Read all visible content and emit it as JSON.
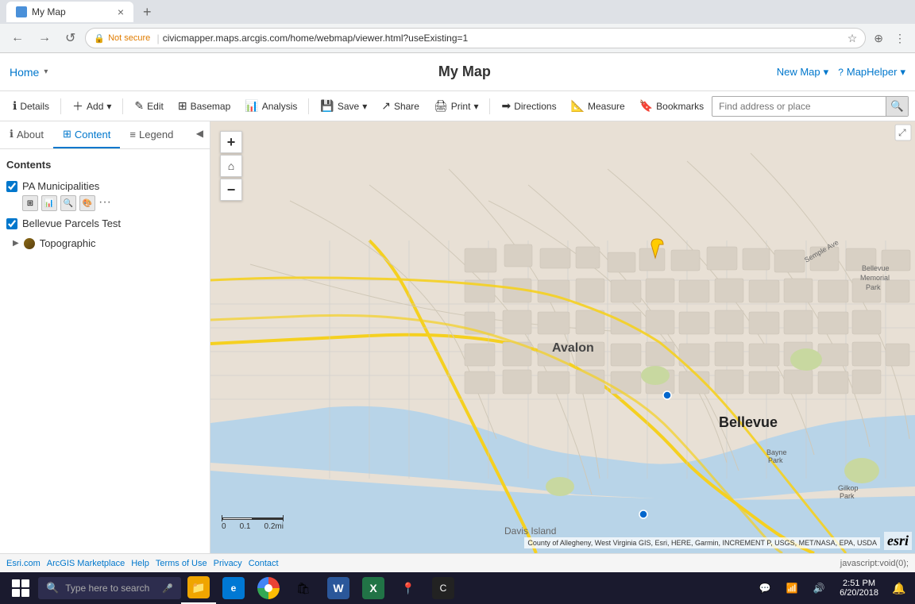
{
  "browser": {
    "tab_title": "My Map",
    "tab_favicon": "map",
    "address_bar": "civicmapper.maps.arcgis.com/home/webmap/viewer.html?useExisting=1",
    "security_label": "Not secure",
    "new_tab_label": "+"
  },
  "app": {
    "logo_text": "Home",
    "logo_arrow": "▾",
    "title": "My Map",
    "header_new_map": "New Map",
    "header_new_map_arrow": "▾",
    "header_map_helper": "MapHelper",
    "header_map_helper_arrow": "▾"
  },
  "toolbar": {
    "details_label": "Details",
    "add_label": "Add",
    "add_arrow": "▾",
    "edit_label": "Edit",
    "basemap_label": "Basemap",
    "analysis_label": "Analysis",
    "save_label": "Save",
    "save_arrow": "▾",
    "share_label": "Share",
    "print_label": "Print",
    "print_arrow": "▾",
    "directions_label": "Directions",
    "measure_label": "Measure",
    "bookmarks_label": "Bookmarks",
    "search_placeholder": "Find address or place"
  },
  "sidebar": {
    "about_tab": "About",
    "content_tab": "Content",
    "legend_tab": "Legend",
    "contents_header": "Contents",
    "layers": [
      {
        "id": "pa-municipalities",
        "name": "PA Municipalities",
        "checked": true,
        "has_icons": true
      },
      {
        "id": "bellevue-parcels",
        "name": "Bellevue Parcels Test",
        "checked": true,
        "has_icons": false
      },
      {
        "id": "topographic",
        "name": "Topographic",
        "checked": false,
        "has_icons": false,
        "is_basemap": true
      }
    ]
  },
  "map": {
    "zoom_in": "+",
    "zoom_out": "−",
    "home": "⌂",
    "attribution": "County of Allegheny, West Virginia GIS, Esri, HERE, Garmin, INCREMENT P, USGS, MET/NASA, EPA, USDA",
    "esri_logo": "esri",
    "scale_labels": [
      "0",
      "0.1",
      "0.2mi"
    ]
  },
  "status_bar": {
    "links": [
      "Esri.com",
      "ArcGIS Marketplace",
      "Help",
      "Terms of Use",
      "Privacy",
      "Contact"
    ],
    "url_text": "javascript:void(0);"
  },
  "taskbar": {
    "search_placeholder": "Type here to search",
    "time": "2:51 PM",
    "date": "6/20/2018",
    "apps": [
      {
        "name": "file-explorer",
        "color": "#f0a500",
        "icon": "📁"
      },
      {
        "name": "edge-browser",
        "color": "#0078d4",
        "icon": "e"
      },
      {
        "name": "chrome-browser",
        "color": "#4caf50",
        "icon": "●"
      },
      {
        "name": "store",
        "color": "#0078d4",
        "icon": "🛍"
      },
      {
        "name": "word",
        "color": "#2b579a",
        "icon": "W"
      },
      {
        "name": "excel",
        "color": "#217346",
        "icon": "X"
      },
      {
        "name": "maps",
        "color": "#e44",
        "icon": "📍"
      },
      {
        "name": "app8",
        "color": "#333",
        "icon": "C"
      }
    ]
  },
  "icons": {
    "info": "ℹ",
    "layers": "⊞",
    "legend": "≡",
    "add": "＋",
    "edit": "✎",
    "basemap": "🗺",
    "analysis": "📊",
    "save": "💾",
    "share": "↗",
    "print": "🖨",
    "directions": "➡",
    "measure": "📏",
    "bookmarks": "🔖",
    "search": "🔍",
    "chevron_left": "◀",
    "checkbox_on": "☑",
    "checkbox_off": "☐",
    "expand": "▶",
    "nav_back": "←",
    "nav_forward": "→",
    "nav_refresh": "↺",
    "star": "☆",
    "menu": "⋮"
  }
}
